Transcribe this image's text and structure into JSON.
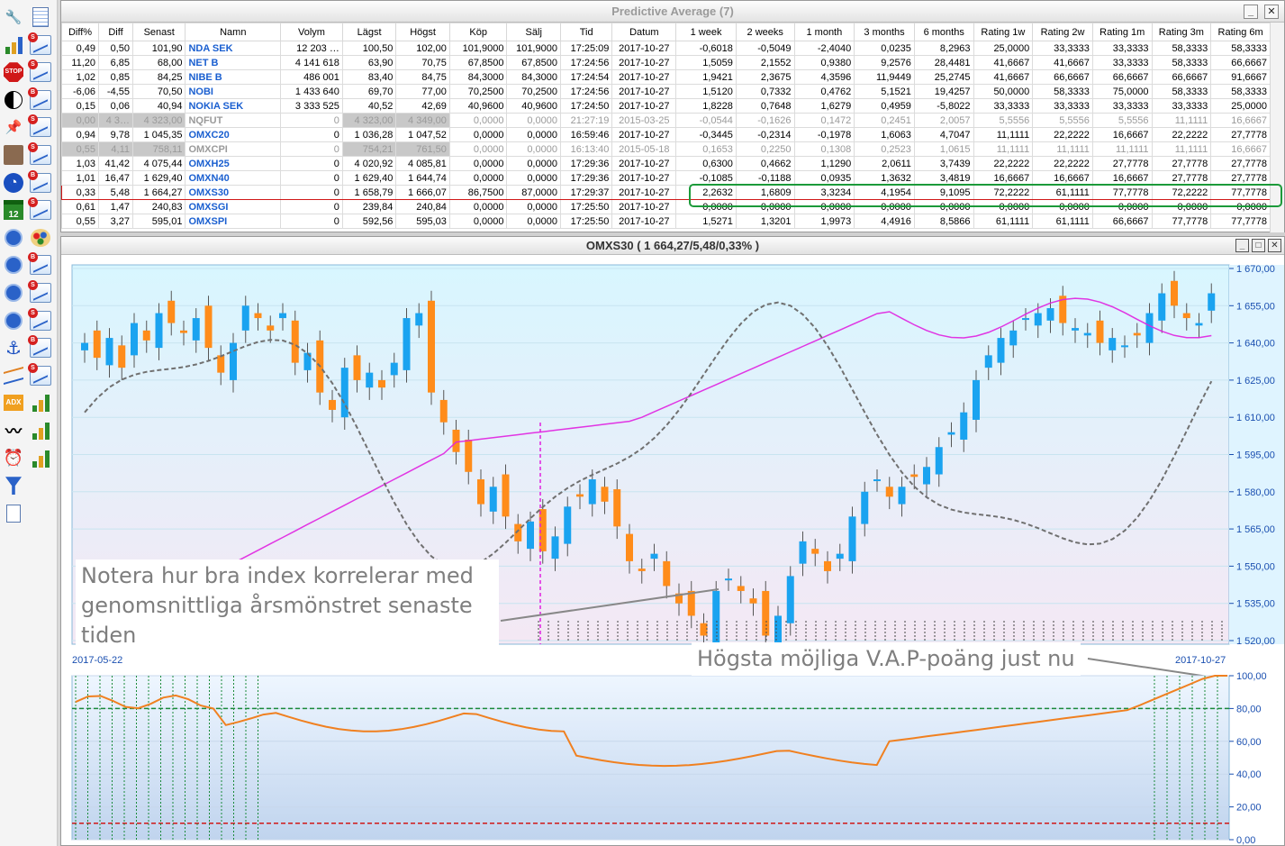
{
  "window_title": "Predictive Average (7)",
  "columns": [
    "Diff%",
    "Diff",
    "Senast",
    "Namn",
    "Volym",
    "Lägst",
    "Högst",
    "Köp",
    "Sälj",
    "Tid",
    "Datum",
    "1 week",
    "2 weeks",
    "1 month",
    "3 months",
    "6 months",
    "Rating 1w",
    "Rating 2w",
    "Rating 1m",
    "Rating 3m",
    "Rating 6m"
  ],
  "rows": [
    {
      "state": "normal",
      "cells": [
        "0,49",
        "0,50",
        "101,90",
        "NDA SEK",
        "12 203 …",
        "100,50",
        "102,00",
        "101,9000",
        "101,9000",
        "17:25:09",
        "2017-10-27",
        "-0,6018",
        "-0,5049",
        "-2,4040",
        "0,0235",
        "8,2963",
        "25,0000",
        "33,3333",
        "33,3333",
        "58,3333",
        "58,3333"
      ]
    },
    {
      "state": "normal",
      "cells": [
        "11,20",
        "6,85",
        "68,00",
        "NET B",
        "4 141 618",
        "63,90",
        "70,75",
        "67,8500",
        "67,8500",
        "17:24:56",
        "2017-10-27",
        "1,5059",
        "2,1552",
        "0,9380",
        "9,2576",
        "28,4481",
        "41,6667",
        "41,6667",
        "33,3333",
        "58,3333",
        "66,6667"
      ]
    },
    {
      "state": "normal",
      "cells": [
        "1,02",
        "0,85",
        "84,25",
        "NIBE B",
        "486 001",
        "83,40",
        "84,75",
        "84,3000",
        "84,3000",
        "17:24:54",
        "2017-10-27",
        "1,9421",
        "2,3675",
        "4,3596",
        "11,9449",
        "25,2745",
        "41,6667",
        "66,6667",
        "66,6667",
        "66,6667",
        "91,6667"
      ]
    },
    {
      "state": "normal",
      "cells": [
        "-6,06",
        "-4,55",
        "70,50",
        "NOBI",
        "1 433 640",
        "69,70",
        "77,00",
        "70,2500",
        "70,2500",
        "17:24:56",
        "2017-10-27",
        "1,5120",
        "0,7332",
        "0,4762",
        "5,1521",
        "19,4257",
        "50,0000",
        "58,3333",
        "75,0000",
        "58,3333",
        "58,3333"
      ]
    },
    {
      "state": "normal",
      "cells": [
        "0,15",
        "0,06",
        "40,94",
        "NOKIA SEK",
        "3 333 525",
        "40,52",
        "42,69",
        "40,9600",
        "40,9600",
        "17:24:50",
        "2017-10-27",
        "1,8228",
        "0,7648",
        "1,6279",
        "0,4959",
        "-5,8022",
        "33,3333",
        "33,3333",
        "33,3333",
        "33,3333",
        "25,0000"
      ]
    },
    {
      "state": "gray",
      "cells": [
        "0,00",
        "4 3…",
        "4 323,00",
        "NQFUT",
        "0",
        "4 323,00",
        "4 349,00",
        "0,0000",
        "0,0000",
        "21:27:19",
        "2015-03-25",
        "-0,0544",
        "-0,1626",
        "0,1472",
        "0,2451",
        "2,0057",
        "5,5556",
        "5,5556",
        "5,5556",
        "11,1111",
        "16,6667"
      ]
    },
    {
      "state": "normal",
      "cells": [
        "0,94",
        "9,78",
        "1 045,35",
        "OMXC20",
        "0",
        "1 036,28",
        "1 047,52",
        "0,0000",
        "0,0000",
        "16:59:46",
        "2017-10-27",
        "-0,3445",
        "-0,2314",
        "-0,1978",
        "1,6063",
        "4,7047",
        "11,1111",
        "22,2222",
        "16,6667",
        "22,2222",
        "27,7778"
      ]
    },
    {
      "state": "gray",
      "cells": [
        "0,55",
        "4,11",
        "758,11",
        "OMXCPI",
        "0",
        "754,21",
        "761,50",
        "0,0000",
        "0,0000",
        "16:13:40",
        "2015-05-18",
        "0,1653",
        "0,2250",
        "0,1308",
        "0,2523",
        "1,0615",
        "11,1111",
        "11,1111",
        "11,1111",
        "11,1111",
        "16,6667"
      ]
    },
    {
      "state": "normal",
      "cells": [
        "1,03",
        "41,42",
        "4 075,44",
        "OMXH25",
        "0",
        "4 020,92",
        "4 085,81",
        "0,0000",
        "0,0000",
        "17:29:36",
        "2017-10-27",
        "0,6300",
        "0,4662",
        "1,1290",
        "2,0611",
        "3,7439",
        "22,2222",
        "22,2222",
        "27,7778",
        "27,7778",
        "27,7778"
      ]
    },
    {
      "state": "normal",
      "cells": [
        "1,01",
        "16,47",
        "1 629,40",
        "OMXN40",
        "0",
        "1 629,40",
        "1 644,74",
        "0,0000",
        "0,0000",
        "17:29:36",
        "2017-10-27",
        "-0,1085",
        "-0,1188",
        "0,0935",
        "1,3632",
        "3,4819",
        "16,6667",
        "16,6667",
        "16,6667",
        "27,7778",
        "27,7778"
      ]
    },
    {
      "state": "sel",
      "cells": [
        "0,33",
        "5,48",
        "1 664,27",
        "OMXS30",
        "0",
        "1 658,79",
        "1 666,07",
        "86,7500",
        "87,0000",
        "17:29:37",
        "2017-10-27",
        "2,2632",
        "1,6809",
        "3,3234",
        "4,1954",
        "9,1095",
        "72,2222",
        "61,1111",
        "77,7778",
        "72,2222",
        "77,7778"
      ]
    },
    {
      "state": "normal",
      "cells": [
        "0,61",
        "1,47",
        "240,83",
        "OMXSGI",
        "0",
        "239,84",
        "240,84",
        "0,0000",
        "0,0000",
        "17:25:50",
        "2017-10-27",
        "0,0000",
        "0,0000",
        "0,0000",
        "0,0000",
        "0,0000",
        "0,0000",
        "0,0000",
        "0,0000",
        "0,0000",
        "0,0000"
      ]
    },
    {
      "state": "normal",
      "cells": [
        "0,55",
        "3,27",
        "595,01",
        "OMXSPI",
        "0",
        "592,56",
        "595,03",
        "0,0000",
        "0,0000",
        "17:25:50",
        "2017-10-27",
        "1,5271",
        "1,3201",
        "1,9973",
        "4,4916",
        "8,5866",
        "61,1111",
        "61,1111",
        "66,6667",
        "77,7778",
        "77,7778"
      ]
    }
  ],
  "chart": {
    "title": "OMXS30 ( 1 664,27/5,48/0,33% )",
    "y_ticks": [
      "1 670,00",
      "1 655,00",
      "1 640,00",
      "1 625,00",
      "1 610,00",
      "1 595,00",
      "1 580,00",
      "1 565,00",
      "1 550,00",
      "1 535,00",
      "1 520,00"
    ],
    "date_start": "2017-05-22",
    "date_end": "2017-10-27",
    "annotation_left": "Notera hur bra index korrelerar med genomsnittliga årsmönstret senaste tiden",
    "annotation_right": "Högsta möjliga V.A.P-poäng just nu",
    "candle_colors": {
      "up": "#1aa3f0",
      "down": "#ff8c1a"
    },
    "series_colors": {
      "seasonal": "#e020e0",
      "pattern": "#707070",
      "score": "#f08020"
    }
  },
  "score_chart": {
    "y_ticks": [
      "100,00",
      "80,00",
      "60,00",
      "40,00",
      "20,00",
      "0,00"
    ],
    "upper_threshold": 80,
    "lower_threshold": 10
  },
  "window_buttons": {
    "minimize": "_",
    "maximize": "□",
    "close": "✕"
  }
}
